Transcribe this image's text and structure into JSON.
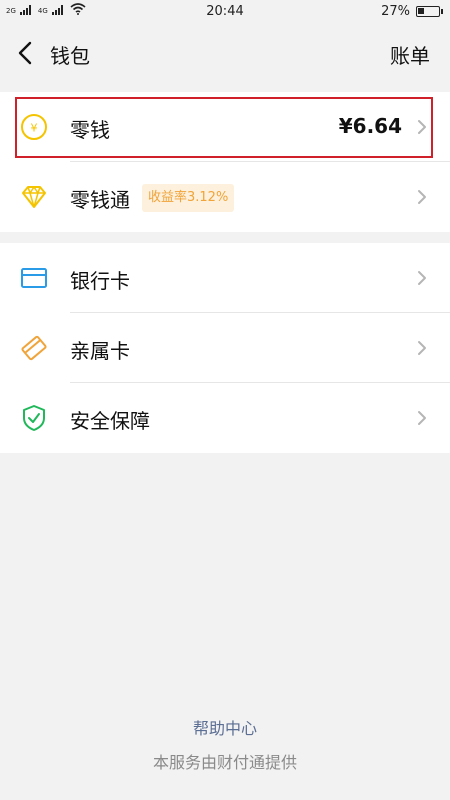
{
  "status_bar": {
    "signal1": "2G",
    "signal2": "4G",
    "time": "20:44",
    "battery_percent": "27%",
    "battery_level": 0.27
  },
  "nav": {
    "title": "钱包",
    "right_label": "账单"
  },
  "wallet": {
    "items": [
      {
        "label": "零钱",
        "amount": "¥6.64",
        "icon": "yuan-coin-icon"
      },
      {
        "label": "零钱通",
        "badge": "收益率3.12%",
        "icon": "diamond-icon"
      }
    ]
  },
  "cards": {
    "items": [
      {
        "label": "银行卡",
        "icon": "bank-card-icon"
      },
      {
        "label": "亲属卡",
        "icon": "family-card-icon"
      },
      {
        "label": "安全保障",
        "icon": "shield-check-icon"
      }
    ]
  },
  "footer": {
    "help_link": "帮助中心",
    "service_note": "本服务由财付通提供"
  },
  "colors": {
    "accent_yellow": "#f5c400",
    "badge_bg": "#fdf0dc",
    "badge_text": "#f0a43a",
    "card_blue": "#2a9be6",
    "family_orange": "#f0a43a",
    "shield_green": "#20b85a",
    "highlight_red": "#d0202a",
    "link_blue": "#5b6e93"
  }
}
